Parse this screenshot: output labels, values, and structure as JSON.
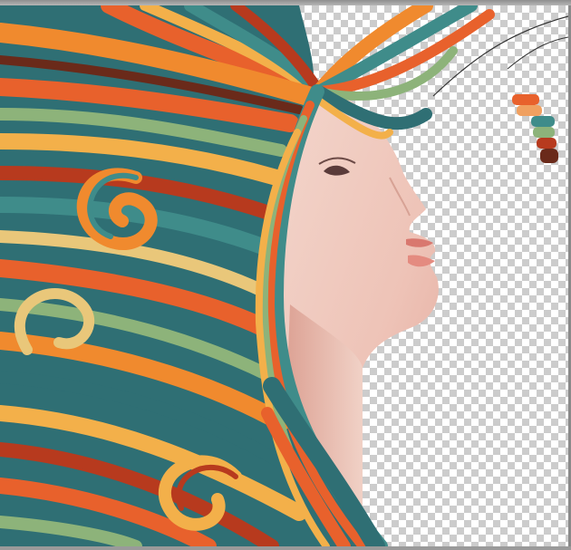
{
  "app": {
    "document_view": "canvas",
    "background": "transparency-checkerboard"
  },
  "artwork": {
    "subject": "woman-portrait-with-flowing-striped-hair",
    "palette": [
      "#e8612c",
      "#f08a2e",
      "#f3b04a",
      "#3f8c8a",
      "#2f6f74",
      "#8db37a",
      "#b73a1e",
      "#6a2a1a",
      "#e9c77a"
    ]
  },
  "swatch_strip": {
    "colors": [
      "#e8612c",
      "#f0a060",
      "#3f8c8a",
      "#8db37a",
      "#b73a1e",
      "#6a2a1a"
    ]
  }
}
